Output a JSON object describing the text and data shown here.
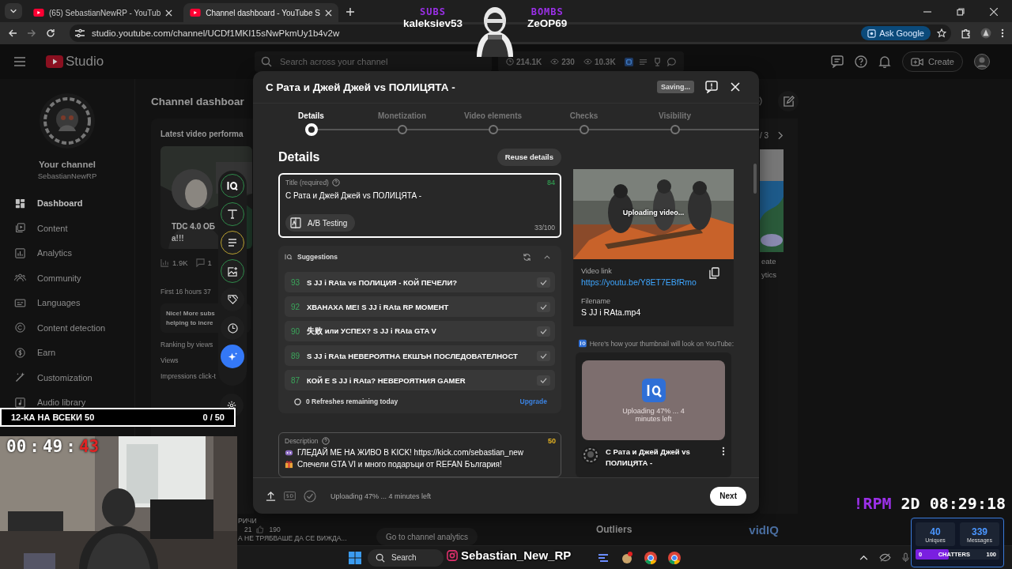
{
  "browser": {
    "tabs": [
      {
        "title": "(65) SebastianNewRP - YouTub",
        "selected": false
      },
      {
        "title": "Channel dashboard - YouTube S",
        "selected": true
      }
    ],
    "url": "studio.youtube.com/channel/UCDf1MKI15sNwPkmUy1b4v2w",
    "ask_google": "Ask Google"
  },
  "studio_header": {
    "logo": "Studio",
    "search": {
      "placeholder": "Search across your channel"
    },
    "stats": [
      {
        "kind": "clock",
        "value": "214.1K"
      },
      {
        "kind": "eye",
        "value": "230"
      },
      {
        "kind": "eye",
        "value": "10.3K"
      }
    ],
    "create": "Create"
  },
  "sidebar": {
    "channel_label": "Your channel",
    "channel_name": "SebastianNewRP",
    "items": [
      {
        "label": "Dashboard",
        "kind": "dashboard",
        "selected": true
      },
      {
        "label": "Content",
        "kind": "content",
        "selected": false
      },
      {
        "label": "Analytics",
        "kind": "analytics",
        "selected": false
      },
      {
        "label": "Community",
        "kind": "community",
        "selected": false
      },
      {
        "label": "Languages",
        "kind": "languages",
        "selected": false
      },
      {
        "label": "Content detection",
        "kind": "copyright",
        "selected": false
      },
      {
        "label": "Earn",
        "kind": "earn",
        "selected": false
      },
      {
        "label": "Customization",
        "kind": "customization",
        "selected": false
      },
      {
        "label": "Audio library",
        "kind": "audio",
        "selected": false
      }
    ]
  },
  "dashboard": {
    "title": "Channel dashboar",
    "card_title": "Latest video performa",
    "video_title": [
      "TDC 4.0 ОБ",
      "a!!!"
    ],
    "views": "1.9K",
    "comments": "1",
    "period": "First 16 hours 37",
    "tip": [
      "Nice! More subs",
      "helping to incre"
    ],
    "metrics": [
      "Ranking by views",
      "Views",
      "Impressions click-t"
    ],
    "page_count": "/ 3",
    "side_text": [
      "eate",
      "ytics"
    ],
    "bottom": {
      "label": "РИЧИ",
      "comments": "21",
      "likes": "190",
      "video_title": "А НЕ ТРЯБВАШЕ ДА СЕ ВИЖДА...",
      "analytics_button": "Go to channel analytics",
      "outliers": "Outliers",
      "brand": "vidIQ"
    }
  },
  "upload_dialog": {
    "title": "С Рата и Джей Джей vs ПОЛИЦЯТА -",
    "saving": "Saving...",
    "steps": [
      {
        "label": "Details",
        "selected": true
      },
      {
        "label": "Monetization",
        "selected": false
      },
      {
        "label": "Video elements",
        "selected": false
      },
      {
        "label": "Checks",
        "selected": false
      },
      {
        "label": "Visibility",
        "selected": false
      }
    ],
    "heading": "Details",
    "reuse": "Reuse details",
    "title_field": {
      "label": "Title (required)",
      "score": "84",
      "value": "С Рата и Джей Джей vs ПОЛИЦЯТА -",
      "ab_testing": "A/B Testing",
      "count": "33/100"
    },
    "suggestions": {
      "title": "Suggestions",
      "items": [
        {
          "score": "93",
          "text": "S JJ i RAta vs ПОЛИЦИЯ - КОЙ ПЕЧЕЛИ?"
        },
        {
          "score": "92",
          "text": "ХВАНАХА МЕ! S JJ i RAta RP МОМЕНТ"
        },
        {
          "score": "90",
          "text": "失败 или УСПЕХ? S JJ i RAta GTA V"
        },
        {
          "score": "89",
          "text": "S JJ i RAta НЕВЕРОЯТНА ЕКШЪН ПОСЛЕДОВАТЕЛНОСТ"
        },
        {
          "score": "87",
          "text": "КОЙ Е S JJ i RAta? НЕВЕРОЯТНИЯ GAMER"
        }
      ],
      "refreshes": "0 Refreshes remaining today",
      "upgrade": "Upgrade"
    },
    "description": {
      "label": "Description",
      "score": "50",
      "lines": [
        {
          "kind": "game",
          "text": "ГЛЕДАЙ МЕ НА ЖИВО В KICK! https://kick.com/sebastian_new"
        },
        {
          "kind": "gift",
          "text": "Спечели GTA VI и много подаръци от REFAN България!"
        }
      ]
    },
    "preview": {
      "status": "Uploading video...",
      "video_link_label": "Video link",
      "video_link": "https://youtu.be/Y8ET7EBfRmo",
      "filename_label": "Filename",
      "filename": "S JJ i RAta.mp4",
      "thumbnail_hint": "Here's how your thumbnail will look on YouTube:",
      "thumbnail_status": "Uploading 47% ... 4 minutes left",
      "video_title": "С Рата и Джей Джей vs ПОЛИЦЯТА -"
    },
    "footer": {
      "status": "Uploading 47% ... 4 minutes left",
      "next": "Next"
    }
  },
  "stream_overlay": {
    "subs": {
      "label": "SUBS",
      "name": "kaleksiev53"
    },
    "bombs": {
      "label": "BOMBS",
      "name": "ZeOP69"
    },
    "goal": {
      "label": "12-КА НА ВСЕКИ 50",
      "count": "0 / 50"
    },
    "timer": [
      {
        "kind": "digits",
        "text": "00"
      },
      {
        "kind": "sep",
        "text": ":"
      },
      {
        "kind": "digits",
        "text": "49"
      },
      {
        "kind": "sep",
        "text": ":"
      },
      {
        "kind": "alert",
        "text": "43"
      }
    ],
    "rpm": {
      "command": "!RPM",
      "days": "2D",
      "time": "08:29:18"
    },
    "chatters": {
      "uniques": "40",
      "uniques_label": "Uniques",
      "messages": "339",
      "messages_label": "Messages",
      "bar_label": "CHATTERS",
      "min": "0",
      "max": "100",
      "level": 0.4
    },
    "social": {
      "handle": "Sebastian_New_RP"
    }
  },
  "taskbar": {
    "search": "Search"
  }
}
